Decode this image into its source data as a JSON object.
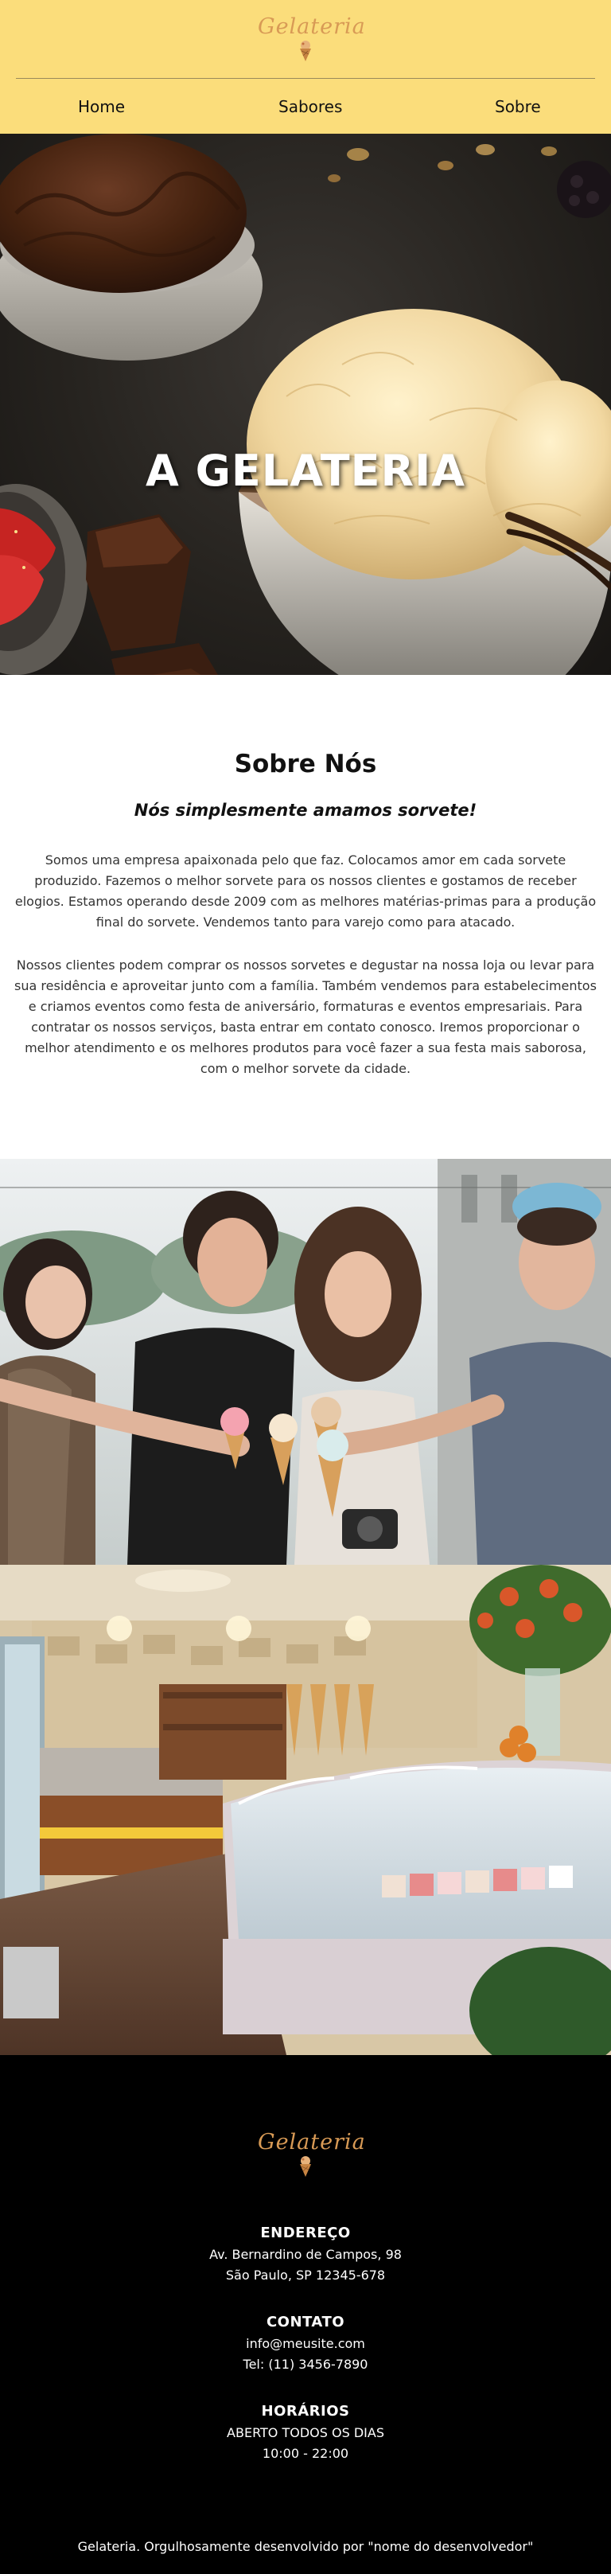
{
  "brand": {
    "logo_text": "Gelateria",
    "colors": {
      "header_bg": "#fbdd7b",
      "logo_accent": "#d89a55",
      "footer_bg": "#000000"
    }
  },
  "nav": {
    "items": [
      {
        "label": "Home"
      },
      {
        "label": "Sabores"
      },
      {
        "label": "Sobre"
      }
    ]
  },
  "hero": {
    "title": "A GELATERIA"
  },
  "about": {
    "title": "Sobre Nós",
    "subtitle": "Nós simplesmente amamos sorvete!",
    "paragraph_1": "Somos uma empresa apaixonada pelo que faz. Colocamos amor em cada sorvete produzido. Fazemos o melhor sorvete para os nossos clientes e gostamos de receber elogios. Estamos operando desde 2009 com as melhores matérias-primas para a produção final do sorvete. Vendemos tanto para varejo como para atacado.",
    "paragraph_2": "Nossos clientes podem comprar os nossos sorvetes e degustar na nossa loja ou levar para sua residência e aproveitar junto com a família. Também vendemos para estabelecimentos e criamos eventos como festa de aniversário, formaturas e eventos empresariais. Para contratar os nossos serviços, basta entrar em contato conosco. Iremos proporcionar o melhor atendimento e os melhores produtos para você fazer a sua festa mais saborosa, com o melhor sorvete da cidade."
  },
  "footer": {
    "address": {
      "heading": "ENDEREÇO",
      "line_1": "Av. Bernardino de Campos, 98",
      "line_2": "São Paulo, SP 12345-678"
    },
    "contact": {
      "heading": "CONTATO",
      "email": "info@meusite.com",
      "phone": "Tel: (11) 3456-7890"
    },
    "hours": {
      "heading": "HORÁRIOS",
      "line_1": "ABERTO TODOS OS DIAS",
      "line_2": "10:00 - 22:00"
    },
    "credit": "Gelateria. Orgulhosamente desenvolvido por \"nome do desenvolvedor\""
  }
}
